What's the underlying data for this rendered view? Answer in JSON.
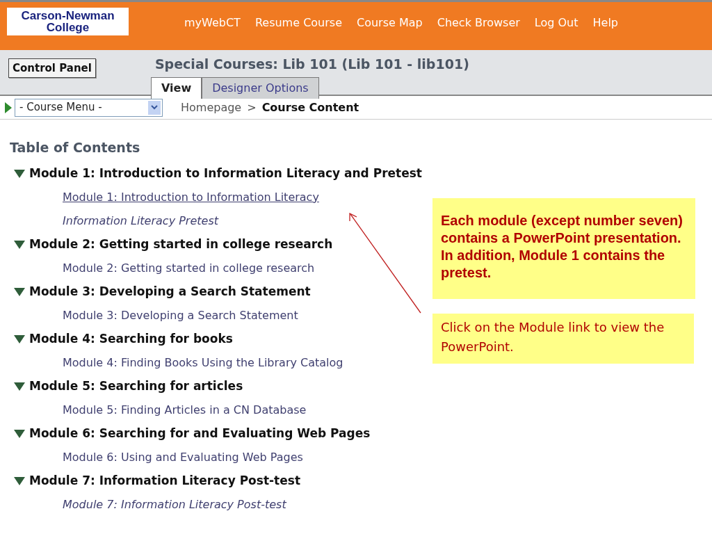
{
  "header": {
    "logo": [
      "Carson-Newman",
      "College"
    ],
    "nav_links": [
      "myWebCT",
      "Resume Course",
      "Course Map",
      "Check Browser",
      "Log Out",
      "Help"
    ]
  },
  "course_bar": {
    "control_panel": "Control Panel",
    "title": "Special Courses: Lib 101  (Lib 101 - lib101)",
    "tabs": [
      {
        "label": "View",
        "selected": true
      },
      {
        "label": "Designer Options",
        "selected": false
      }
    ]
  },
  "nav_row": {
    "course_menu": "- Course Menu -",
    "breadcrumb": [
      {
        "label": "Homepage",
        "current": false
      },
      {
        "label": "Course Content",
        "current": true
      }
    ],
    "breadcrumb_separator": ">"
  },
  "toc": {
    "title": "Table of Contents",
    "modules": [
      {
        "title": "Module 1: Introduction to Information Literacy and Pretest",
        "expanded": true,
        "children": [
          {
            "label": "Module 1: Introduction to Information Literacy",
            "kind": "page",
            "hovered": true
          },
          {
            "label": "Information Literacy Pretest",
            "kind": "quiz",
            "hovered": false
          }
        ]
      },
      {
        "title": "Module 2: Getting started in college research",
        "expanded": true,
        "children": [
          {
            "label": "Module 2: Getting started in college research",
            "kind": "page",
            "hovered": false
          }
        ]
      },
      {
        "title": "Module 3: Developing a Search Statement",
        "expanded": true,
        "children": [
          {
            "label": "Module 3: Developing a Search Statement",
            "kind": "page",
            "hovered": false
          }
        ]
      },
      {
        "title": "Module 4: Searching for books",
        "expanded": true,
        "children": [
          {
            "label": "Module 4: Finding Books Using the Library Catalog",
            "kind": "page",
            "hovered": false
          }
        ]
      },
      {
        "title": "Module 5: Searching for articles",
        "expanded": true,
        "children": [
          {
            "label": "Module 5: Finding Articles in a CN Database",
            "kind": "page",
            "hovered": false
          }
        ]
      },
      {
        "title": "Module 6: Searching for and Evaluating Web Pages",
        "expanded": true,
        "children": [
          {
            "label": "Module 6: Using and Evaluating Web Pages",
            "kind": "page",
            "hovered": false
          }
        ]
      },
      {
        "title": "Module 7: Information Literacy Post-test",
        "expanded": true,
        "children": [
          {
            "label": "Module 7: Information Literacy Post-test",
            "kind": "quiz",
            "hovered": false
          }
        ]
      }
    ]
  },
  "callouts": [
    {
      "text": "Each module (except number seven) contains a PowerPoint presentation.  In addition, Module 1 contains the pretest.",
      "kind": "bold"
    },
    {
      "text": "Click on the Module link to view the PowerPoint.",
      "kind": "plain"
    }
  ]
}
